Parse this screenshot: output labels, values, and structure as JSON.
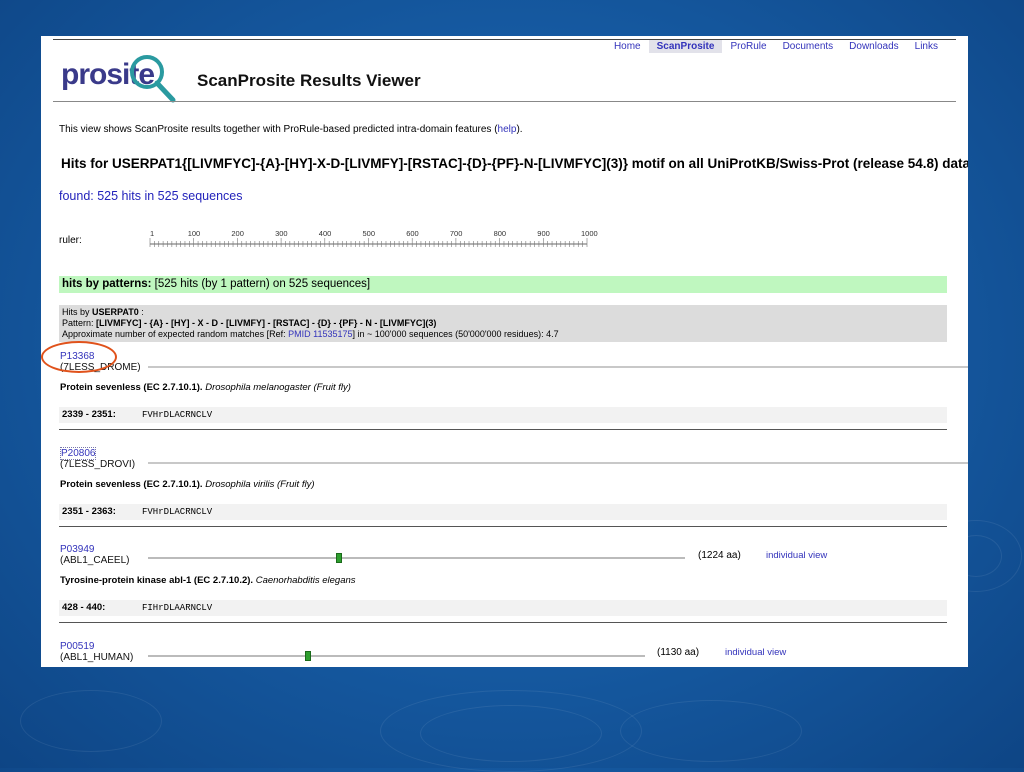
{
  "colors": {
    "accent_link": "#3333bb",
    "patterns_bar": "#bff7bf",
    "highlight_circle": "#e0521b",
    "marker": "#2e9e2e"
  },
  "logo": {
    "text": "prosite",
    "icon": "magnifier-icon"
  },
  "header": {
    "title": "ScanProsite Results Viewer"
  },
  "nav": {
    "items": [
      "Home",
      "ScanProsite",
      "ProRule",
      "Documents",
      "Downloads",
      "Links"
    ],
    "active": "ScanProsite"
  },
  "intro": {
    "text": "This view shows ScanProsite results together with ProRule-based predicted intra-domain features (",
    "link": "help",
    "end": ")."
  },
  "hits_title": "Hits for USERPAT1{[LIVMFYC]-{A}-[HY]-X-D-[LIVMFY]-[RSTAC]-{D}-{PF}-N-[LIVMFYC](3)} motif on all UniProtKB/Swiss-Prot (release 54.8) datab",
  "found": "found: 525 hits in 525 sequences",
  "ruler": {
    "label": "ruler:",
    "ticks": [
      "1",
      "100",
      "200",
      "300",
      "400",
      "500",
      "600",
      "700",
      "800",
      "900",
      "1000"
    ]
  },
  "patterns_bar": {
    "label": "hits by patterns:",
    "text": "[525 hits (by 1 pattern) on 525 sequences]"
  },
  "pattern_box": {
    "line1_prefix": "Hits by",
    "line1_name": "USERPAT0",
    "line1_suffix": ":",
    "line2_prefix": "Pattern:",
    "line2_pattern": "[LIVMFYC] - {A} - [HY] - X - D - [LIVMFY] - [RSTAC] - {D} - {PF} - N - [LIVMFYC](3)",
    "line3_prefix": "Approximate number of expected random matches [Ref:",
    "line3_link": "PMID 11535175",
    "line3_suffix": "] in ~ 100'000 sequences (50'000'000 residues): 4.7"
  },
  "entries": [
    {
      "acc": "P13368",
      "name": "(7LESS_DROME)",
      "desc_bold": "Protein sevenless (EC 2.7.10.1).",
      "desc_italic": "Drosophila melanogaster (Fruit fly)",
      "range": "2339 - 2351:",
      "seq": "FVHrDLACRNCLV",
      "aa": "",
      "iview": ""
    },
    {
      "acc": "P20806",
      "name": "(7LESS_DROVI)",
      "desc_bold": "Protein sevenless (EC 2.7.10.1).",
      "desc_italic": "Drosophila virilis (Fruit fly)",
      "range": "2351 - 2363:",
      "seq": "FVHrDLACRNCLV",
      "aa": "",
      "iview": ""
    },
    {
      "acc": "P03949",
      "name": "(ABL1_CAEEL)",
      "desc_bold": "Tyrosine-protein kinase abl-1 (EC 2.7.10.2).",
      "desc_italic": "Caenorhabditis elegans",
      "range": "428 - 440:",
      "seq": "FIHrDLAARNCLV",
      "aa": "(1224 aa)",
      "iview": "individual view"
    },
    {
      "acc": "P00519",
      "name": "(ABL1_HUMAN)",
      "desc_bold": "",
      "desc_italic": "",
      "range": "",
      "seq": "",
      "aa": "(1130 aa)",
      "iview": "individual view"
    }
  ]
}
